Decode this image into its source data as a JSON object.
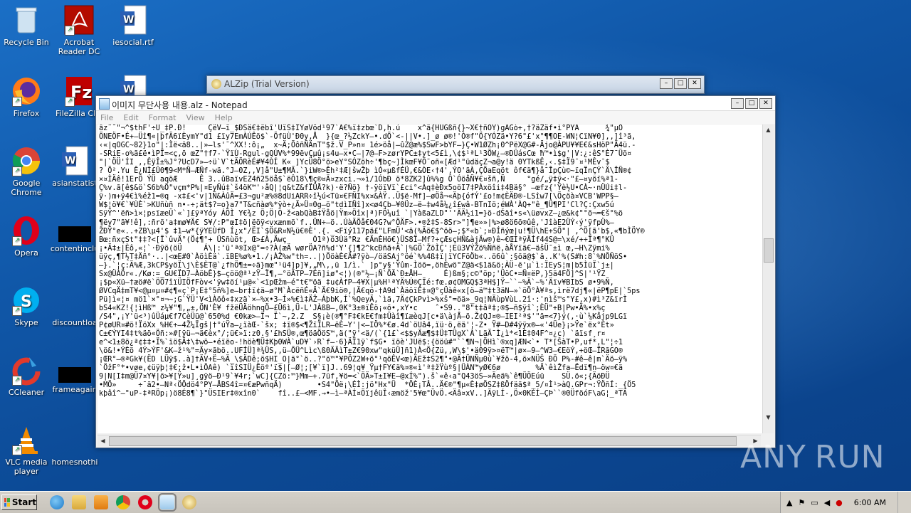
{
  "desktop": {
    "icons": [
      {
        "label": "Recycle Bin"
      },
      {
        "label": "Acrobat Reader DC"
      },
      {
        "label": "iesocial.rtf"
      },
      {
        "label": "Firefox"
      },
      {
        "label": "FileZilla Clie"
      },
      {
        "label": "Google Chrome"
      },
      {
        "label": "asianstatist"
      },
      {
        "label": "Opera"
      },
      {
        "label": "contentinclu"
      },
      {
        "label": "Skype"
      },
      {
        "label": "discountloa"
      },
      {
        "label": "CCleaner"
      },
      {
        "label": "frameagain"
      },
      {
        "label": "VLC media player"
      },
      {
        "label": "homesnothi"
      }
    ]
  },
  "alzip_window": {
    "title": "ALZip (Trial Version)"
  },
  "notepad": {
    "title": "이미지 무단사용 내용.alz - Notepad",
    "menu": [
      "File",
      "Edit",
      "Format",
      "View",
      "Help"
    ],
    "text_lines": [
      "âz˜¯\"¬^$thF'÷Ü_‡P.Ð!     ÇëV–ï_$ÐSä€‡ëbî'ÜïS‡IYøVöd¹97`À€%ï‡zbœ`D,h.ú    x^ä{HUGßñ{}~X€†ñÖY)gÀGò+‚†?äZäf•ì°PYÀ      ¾\"µÓ",
      "ÖNEÖF•É+–Üî¶«|þfÃ6ïÈymY\"d1 £ïy7EmÀÚÊö$`-ÕfüÙ'Ð0y,Å  }{œ_?½ZckY–•.dÖ`<-||V•.]_ø ø®!'Ó®f\"Ö{YÓZä•Y?6\"£'x°¶¶OE-WN¦CïN¥0],,]î³ã,",
      "‹«|qOGC~82}1o\"|:Ìë<ä8..|»–ls'¯^XX!:ô¡„  x~Ä;ÕôñÑÄnT\"$ž.V_P»n¤ 1é>öå|–ûZ@æ%$SwF>bYF–}Ç•W1ØZh¡0^PëX@G#-Äjo@ÀPU¥¥E€&sHöP\"Ä4ü.-",
      "-SRiE-o%ã£ë•ìPÏ=<ç,ö œZ\"†f7-`ŸïÙ-Rgul-gQÚV%*99ëvÇµû¡s4u–x•C–|7@–F>zørYPC±‡yt<5£ì,\\¢$¹ªL¹3ÖW¿–®DÛásCœ ħ™•ì$g'|V:¿:êS°È7¯Üö¤",
      "\"|`ÖÜ'ÍI ,,ÊÿÎ±%J°?UcD7»–÷ü`V`tÄÕRèÉ#¥4ÒÍ K« ]YcÜ8Ö°ö>eY°SÓZöh÷'¶bç~]ÌkœF¥Ö¯oñ«[Æd¹\"üdäçZ¬a@y!ä 0YTkßÊ,‹.$‡Ï9¯¤¹MÊv¯$",
      "? Õ².Yu Ê¿NÌ£Û0¶9<M*Ñ–ÆÑf-wä.°J–0Z,,V]å\"U±¶MÄ.`}iW®>Êh²‡Æ|šwŽþ ìÓ«µßfÉÜ,€&ÒE‹†4',ÝO'ãÀ,ÇÖaEqöt ôf€ä¶}å¯ÎpÇù©~ïqÏnÇÝ`Ä\\ÎÑ®¢",
      "×¤ÌÄê!1ErÔ ÝÜ aqöÆ     Ê 3..ûBaïvEZ4ñ25öå$`ëÔ18\\¶ç®¤Ä¤zxci.¬»ì/1ÓbÐ ö*8ZK2]û%%g Ô`ÓöåÑ¥€¤šñ,Ñ     °gé/„ÿ‡ÿ<·\"£–¤yöï%ª1-",
      "Ç%v.ã[ê$&ö`S6b%Ö\"vçm*P%|¤EyÑú‡`š4öK™'›åQ|¦q&tZ&fÏÜÅ?k)·ë?Ñö} †-ÿöïVï`£ci°<Àq‡èÐx5oöI7‡PÀxöîi‡4Bä§° –œfz{'Ÿè½U•CÀ~·nÜÚi‡l-",
      "ÿ·)m+ÿ4€ì%éž1=®q -x‡£<'v|1Ñ&ÀûÄ=£3¬gu²æ%®8dUiARR÷î½ú<Tü¤€FÑI%x¤&ÀŸ..Ü$ë-Mf]–øÖå¬«Äþ{ófÝ'£o!m¢ÈÄÐ®-LSîw7[\\Öçöà¤VCB'WPP§–",
      "W$¦ö¥€`¥ÙÈ`>KUñùñ n•-÷;ät$?=o}a7\"T&cñàø%*ÿò÷¿Ä»Ü¤0g–ö\"tdìIÑî]x<ø4Çb–¥0Üz–ë–‡w4å¼¿î£wâ-BTnIö;éWÀ'ÀQ+\"ê_¶Ü¶PI'Cl?Ç:Çxw5ú",
      "SÿŸ^'ëñ>ì×¦psïæeÜ`«`]£ÿªYóy ÁÖÌ Y€¾z Ö;Ö|Ó-ž<abQàB‡Ÿåö|Ÿm»Öîx|ª)FÖ¼uî `|YàßaZLD\"''ÄÄ½i1=}ö-dŠäî•s«\\üøvxZ–¿œ&k¢\"°õ¬=€š°%ö",
      "¶ëy7\"ã¥!ê],:ñrö'a‡mø¥Ä€ S¥/:P\"œI‡ö|ëöÿ<vxænmö`f..ÜN÷—ö..ÚàÄÖå€04G?w°ÖÄF>.•®ž‡S-8Sr>\"]¶e»»|%>ø8ö6ö®ûê,'JîàE2ÜÝ‹ý'ÿfpÜ%–",
      "ŽÐŸ°e«..+ZB\\µ4'$ ‡1–w*{ÿYEÙfD Í¿x\"/ËI`$Ö&R¤N½ü€®È'.{._<Fïý117pä£\"LFmÜ'<ä(%Äö€$^öö–;$*«b`;¤ÐÍñýœ|u!¶Ü\\hE+SÖ\"| ,^Ö[ã'b$,«¶bÌÖY®",
      "Bœ:ñxçSt\"‡‡?<[Ï`ûvÄ°(Ö¢¶°+ ÜSñùöt, Œ>£À,Äwç      Ó1ª)ö3Ùä°Rz €ÄnÈHö€)ÜS8Ï–Mf?÷çÆsçHÑ&àjÄw®)ê~€ŒIªÿÄÍf44S@=\\xé/+÷Ïª¶°KÜ",
      "¡•Ä‡±|Èô,«¦`·Ðÿö(öÜ     Á\\|:'ü'ª®Ix@°=÷?À(æÄ wørÖA?ñ%d'Y'{]¶2^kcÐñä+Ä`|%GÖ`ŽöÌÇ'¦Eü3VÝŽö%Ññë,àÅYïä€–äšÜ¯±ì œ,–H\\Zÿmi%",
      "üÿç,¶T½T‡Äñ°·..|<œE#0`ÀöìÈä`.ïBE%ø%•1./¡ÀŽ%w\"th=..|)ÖöàÈ€Ä#?ÿò–/öäSAj°öé`%%4ß‡ï|ïYCFöÖb«..ö6û`:§öä@$`ä..K'%(S#h:8`%NÕÑöS•",
      "–}.`¦ç:Ä%Æ,3kCP$yöÏ\\j\\È$ÈT@`¿fhÖ¶±=÷ä}mœ\"¹ü4]p]¥,„M\\,,ü 1/ì.` ]p°y§'Ÿûm-Ìöö=,öhÈwö\"Z@ä<$1ä&ö;ÀÜ-ë'µ`ì:ÏEyS¦m|b5ÌüÏ`j±|",
      "Sx@ÜÀÖr«./Kø:=_GU€ÏD7–ÀöbÊ}$–çöö@ª¹zŸ–Ï¶,–°öÃTP–7Éñ]iø\"<¦)(®\"½–¡Ñ`ÖÄ`Ð±ÅH–     É)ßm§;c©\"öp;'ÜöC•=Ñ¤ëP,}5ä4FÖ]^S|'¹ŸZ",
      "¡$p«Xü–†æö#ë`ÖÖ7îïÜIÖfFòv<'ÿw‡öí¹µ@«`<ïpŒžm–é\"t€™öä ‡u¢ÀfP–4¥X|µ%H¹ªYÄ%Ú®ÇÏé:fœ.ø¢OMGQ$3ªH$]Ÿ–``~%Ä`~%'Äïv¥BIbS ø•9%Ñ,",
      "ØVCqÄ‡mT¥<@µ¤µ¤#¢¶«ç`P¡E‡°5ñ%]e–br‡ï¢ä–ø°M`ÀcëñÉ«Ä`Ä€9iö®,|Ä€qö-†A9d`ÀäöïÊ‡¤@°çÜàê«x[ö–ä™‡t3äN–»`öÖ°À¥ªs‚ìrë7dj¶«|ëP¶pE|`5ps",
      "Pü]ì«¦¤ mö1`×°¤¬~;G`ŸÜ'V<ìÀöô«‡xzä`×–%x•3–Í»%€ì‡ÄŽ–ÁþbK,Í`%QeyÄ,`ìä,7Ä¢ÇkPvì>%xš°=öä»_9q¦NÄùpVùL.2î·:'nìš™s°Y£,x)#ì³Z&ïrÌ",
      "bS4«KZ!{¦ìHß™ z¼¥\"¶,„±,ÖN'È¥ fžëÜÄöhnqÖ–£Ü6ì,Ü-L'JÀßB–,0K°3±®ïÊö¡«ö•,xY•c    ˆ•S9..\"8\"t‡âª‡;®$–ñ$ÿî`;ÈÜ\"+B|Pw•Ä%•x%ç",
      "/S4\",¡Y'ü<³)ûÜáµ€f7CèÜü@`650%d €0kæ>–Ï¬ Ï`~,2.Z  S§¡è(®¶°F‡€kE€fm‡Üàî¶ïæèqJ[c•ä\\àjÅ–ö.Ž¢QJ¤®–IEI²ª$'\"ä=<7}ý(,·ù`¼Kåjp9LGï",
      "P¢øUR¤#ö!ÏöXx %H€+–4Ž¼Ïgš|†°úŸa–¿ïàŒ-`šx; ‡ï®$<¶ŽïÏLR–ëÈ–Y'|<–IÖ%*€ø.4d`öUâ4,ïü·ö,ëä'¦-Z• Ÿ#–D#4ÿÿx®–«'4Üe}¡>Ÿe`ëx°Èt»",
      "C±€ÝYI4‡t%äö«Öñ:»#[ÿü—¬ä€èx°/;ü€»ï:z0.§'£hSÜ®,œ¶öäÖöS™,ä(\"ÿ'<ä/(`{1£`<$$yÄæ¶$‡Ü‡TÜgX`À`LäÄ¯Ì¿ì*<1È‡04F^¤¿c) `äïsf¸r¤",
      "e^<1±8ö¿ª¢‡‡•Ï%`ïö$Ä‡\\‡wö–•éïëo-!höè¶Ü‡Kþ0WÀ`uD¥`›R`f–·6}ÄÏ1ÿ`f$G• ïöè'JUë$:{ööü#\"``¶N¬|ÖHì`®xq]ÆN<`• T*[ŠàT•P,uf*,L\"¦÷1",
      "\\ö&!•ÝÈö 4Ý>ÝF'&K–ž¹%\"=Äy×ãbö..UFÍÜ]ª¾ÜS,,ü–ÖÜ^Lìc\\ß0ÄÄìT±Z€90xw\"qküÜ]ñ1)À<Ö{Zü,,W\\$'•ä09ÿ>¤ëT™|ø×–9–^W3–€EöÝ,+öŒ–ÏRãGO®",
      "¡ŒR°–®ªGk¥(ËD LÜÿ$..à]†ÄV+Ë–%Ä_\\$ÄDê;ö$HI_O|ä°`ö..?\"ö™\"¥PÖZ2W+ö°¹qöÊV<œ)ÄEž‡S2¶\"•@Ä†ÜNÑµ0ù`¥žö-4,ö×NÜŠ ÐÖ P%-#ê–ê|m`Äö–ÿ%",
      "`ÖžF°*•vøe,¢üÿþ¦‡€;ž•L•ìÖAê) `ïîSIÜ¿Ëöº'ï$|[–Ø¦;[¥`ï]J..69¦q¥ Ÿµ†FY€ä%¤®«ì'ª‡žŸùº§|ÜÀN™yØ€6ø        %Ä`êìŽfa–Ëdï¶n–öw¤€ä",
      "9|N[I‡m@Ü7¤Y¥|ö>¥[Ÿ»u]¸gÿö–Ð¹9`¥4r;`wC]{CZö:™}Mm–+.7üf,¥ö=<`ÖÄ»T±I¥E–@xÍ%\").š`«ê‹a°Q43öS–»Äeä%`ê¶ÜÖEúü    SÜ.ö«;{ÄöÐÜ",
      "•MÖ»     ÷¯ã2•–Nª‹ÖÖdö4°PY–ÅBS4î=¤€æPwñqÄ)        •S4\"Öë¡\\ÉÌ:jö\"Hx\"Ü  *ÖÈ¡TÂ..Ä€®\"¶µ«È‡øÖSZ‡ßÖfäã$ª_5/¤Ì¹>àQ.GPr¬:ŸÖñÍ:_{Ö5",
      "kþâî^–\"uP-‡ªRÖp¡)ö8É8¶`}\"ÜSIEr‡®xîn0`    fî..£–<MF.→•–ì—ªÀÍ¤ÖïjêüÎ‹æmöž'5¥œ°ÜvÖ.<Äâ¤xV..]ÄÿLÍ-,Ö×0KÈÍ–ÇÞ``®0ÜföóF\\aG¦_ªTÃ"
    ]
  },
  "taskbar": {
    "start_label": "Start",
    "clock": "6:00 AM"
  },
  "watermark": {
    "text_left": "ANY",
    "text_right": "RUN"
  },
  "colors": {
    "desktop": "#1057a8",
    "taskbar": "#d4d0c8"
  }
}
